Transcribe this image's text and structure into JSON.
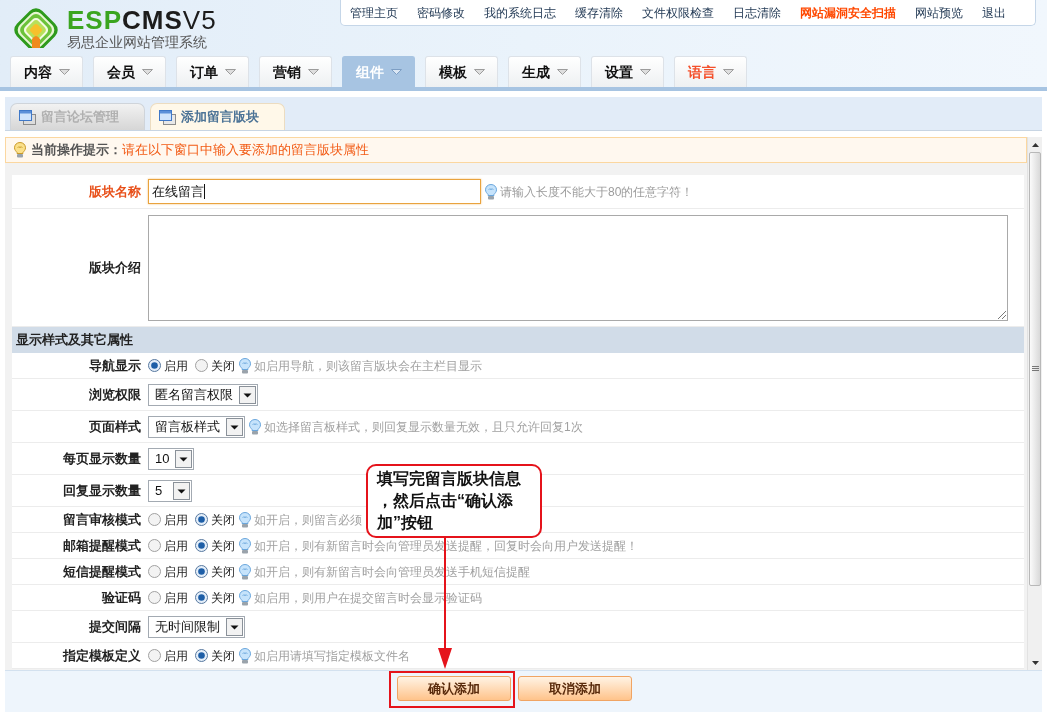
{
  "logo": {
    "wordmark": [
      {
        "kind": "name",
        "text": "ESP",
        "color": "#3aa51f"
      },
      {
        "kind": "name",
        "text": "CMS",
        "color": "#1c1c1c"
      },
      {
        "kind": "version",
        "text": "V5",
        "color": "#1c1c1c"
      }
    ],
    "subtitle": "易思企业网站管理系统"
  },
  "top_links": [
    {
      "label": "管理主页",
      "highlighted": false
    },
    {
      "label": "密码修改",
      "highlighted": false
    },
    {
      "label": "我的系统日志",
      "highlighted": false
    },
    {
      "label": "缓存清除",
      "highlighted": false
    },
    {
      "label": "文件权限检查",
      "highlighted": false
    },
    {
      "label": "日志清除",
      "highlighted": false
    },
    {
      "label": "网站漏洞安全扫描",
      "highlighted": true
    },
    {
      "label": "网站预览",
      "highlighted": false
    },
    {
      "label": "退出",
      "highlighted": false
    }
  ],
  "nav_tabs": [
    {
      "label": "内容",
      "selected": false,
      "highlighted": false
    },
    {
      "label": "会员",
      "selected": false,
      "highlighted": false
    },
    {
      "label": "订单",
      "selected": false,
      "highlighted": false
    },
    {
      "label": "营销",
      "selected": false,
      "highlighted": false
    },
    {
      "label": "组件",
      "selected": true,
      "highlighted": false
    },
    {
      "label": "模板",
      "selected": false,
      "highlighted": false
    },
    {
      "label": "生成",
      "selected": false,
      "highlighted": false
    },
    {
      "label": "设置",
      "selected": false,
      "highlighted": false
    },
    {
      "label": "语言",
      "selected": false,
      "highlighted": true
    }
  ],
  "sub_tabs": [
    {
      "label": "留言论坛管理",
      "selected": false
    },
    {
      "label": "添加留言版块",
      "selected": true
    }
  ],
  "notice": {
    "label": "当前操作提示：",
    "message": "请在以下窗口中输入要添加的留言版块属性"
  },
  "form": {
    "fields": [
      {
        "kind": "text",
        "label": "版块名称",
        "emphasized": true,
        "focused": true,
        "value": "在线留言",
        "hint": "请输入长度不能大于80的任意字符！"
      },
      {
        "kind": "textarea",
        "label": "版块介绍",
        "emphasized": false,
        "focused": false
      }
    ],
    "section": {
      "title": "显示样式及其它属性",
      "rows": [
        {
          "kind": "radio",
          "label": "导航显示",
          "options": [
            {
              "label": "启用",
              "selected": true
            },
            {
              "label": "关闭",
              "selected": false
            }
          ],
          "hint": "如启用导航，则该留言版块会在主栏目显示"
        },
        {
          "kind": "select",
          "label": "浏览权限",
          "value": "匿名留言权限"
        },
        {
          "kind": "select",
          "label": "页面样式",
          "value": "留言板样式",
          "hint": "如选择留言板样式，则回复显示数量无效，且只允许回复1次"
        },
        {
          "kind": "select",
          "label": "每页显示数量",
          "value": "10"
        },
        {
          "kind": "select",
          "label": "回复显示数量",
          "value": "5"
        },
        {
          "kind": "radio",
          "label": "留言审核模式",
          "options": [
            {
              "label": "启用",
              "selected": false
            },
            {
              "label": "关闭",
              "selected": true
            }
          ],
          "hint": "如开启，则留言必须"
        },
        {
          "kind": "radio",
          "label": "邮箱提醒模式",
          "options": [
            {
              "label": "启用",
              "selected": false
            },
            {
              "label": "关闭",
              "selected": true
            }
          ],
          "hint": "如开启，则有新留言时会向管理员发送提醒，回复时会向用户发送提醒！"
        },
        {
          "kind": "radio",
          "label": "短信提醒模式",
          "options": [
            {
              "label": "启用",
              "selected": false
            },
            {
              "label": "关闭",
              "selected": true
            }
          ],
          "hint": "如开启，则有新留言时会向管理员发送手机短信提醒"
        },
        {
          "kind": "radio",
          "label": "验证码",
          "options": [
            {
              "label": "启用",
              "selected": false
            },
            {
              "label": "关闭",
              "selected": true
            }
          ],
          "hint": "如启用，则用户在提交留言时会显示验证码"
        },
        {
          "kind": "select",
          "label": "提交间隔",
          "value": "无时间限制"
        },
        {
          "kind": "radio",
          "label": "指定模板定义",
          "options": [
            {
              "label": "启用",
              "selected": false
            },
            {
              "label": "关闭",
              "selected": true
            }
          ],
          "hint": "如启用请填写指定模板文件名"
        }
      ]
    }
  },
  "footer": {
    "buttons": [
      {
        "label": "确认添加",
        "highlighted": true
      },
      {
        "label": "取消添加",
        "highlighted": false
      }
    ]
  },
  "callout": {
    "text": "填写完留言版块信息，然后点击“确认添加”按钮"
  }
}
